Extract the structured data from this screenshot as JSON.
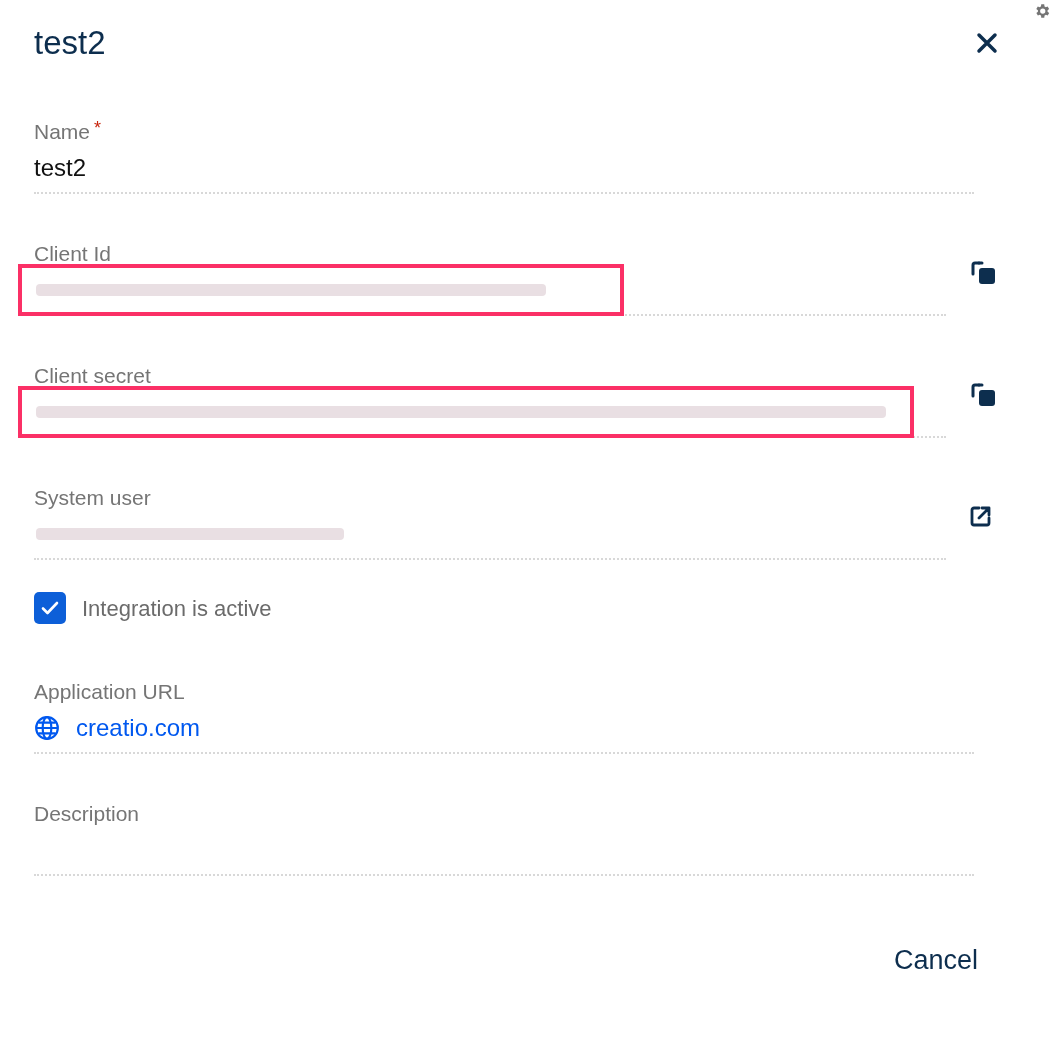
{
  "dialog": {
    "title": "test2"
  },
  "fields": [
    {
      "kind": "text",
      "label": "Name",
      "required_mark": "*",
      "value": "test2"
    },
    {
      "kind": "copy",
      "label": "Client Id",
      "redacted": true,
      "highlighted": true
    },
    {
      "kind": "copy",
      "label": "Client secret",
      "redacted": true,
      "highlighted": true
    },
    {
      "kind": "lookup",
      "label": "System user",
      "redacted": true,
      "highlighted": false
    },
    {
      "kind": "checkbox",
      "label": "Integration is active",
      "checked": true
    },
    {
      "kind": "link",
      "label": "Application URL",
      "value": "creatio.com"
    },
    {
      "kind": "text",
      "label": "Description"
    }
  ],
  "buttons": [
    {
      "label": "Cancel"
    }
  ]
}
